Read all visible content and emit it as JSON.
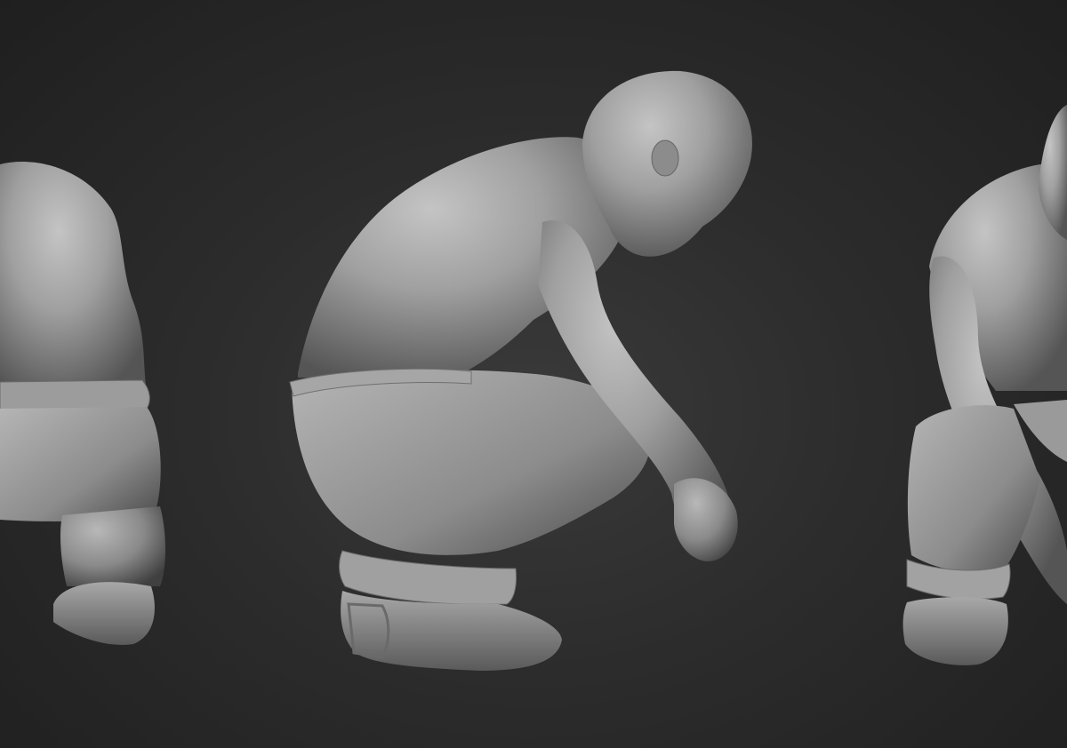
{
  "scene": {
    "background_color": "#2e2e2e",
    "model_color": "#9a9a9a",
    "views": [
      {
        "name": "back-view",
        "description_visible": false
      },
      {
        "name": "side-view",
        "description_visible": false
      },
      {
        "name": "front-view",
        "description_visible": false
      }
    ]
  }
}
